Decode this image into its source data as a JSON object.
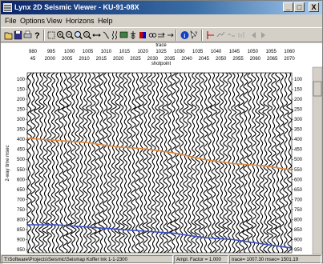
{
  "window": {
    "title": "Lynx 2D Seismic Viewer - KU-91-08X",
    "controls": [
      "_",
      "□",
      "X"
    ]
  },
  "menu": [
    "File",
    "Options",
    "View",
    "Horizons",
    "Help"
  ],
  "toolbar": {
    "icons": [
      "open-file-icon",
      "save-icon",
      "print-icon",
      "question-icon",
      "select-icon",
      "zoom-in-icon",
      "zoom-out-icon",
      "zoom-area-icon",
      "zoom-fit-icon",
      "pan-icon",
      "measure-icon",
      "wiggle-icon",
      "display-icon",
      "gain-icon",
      "color-icon",
      "link-icon",
      "refresh-icon",
      "info-icon",
      "help-pointer-icon",
      "pick-horizon-icon",
      "pick-line-icon",
      "edit-horizon-icon",
      "snap-icon",
      "back-icon",
      "forward-icon"
    ]
  },
  "plot": {
    "top_axis_title_1": "trace",
    "top_axis_title_2": "shotpoint",
    "trace_ticks": [
      "980",
      "995",
      "1000",
      "1005",
      "1010",
      "1015",
      "1020",
      "1025",
      "1030",
      "1035",
      "1040",
      "1045",
      "1050",
      "1055",
      "1060"
    ],
    "shotpoint_ticks": [
      "45",
      "2000",
      "2005",
      "2010",
      "2015",
      "2020",
      "2025",
      "2030",
      "2035",
      "2040",
      "2045",
      "2050",
      "2055",
      "2060",
      "2065",
      "2070"
    ],
    "y_axis_label": "2-way time msec",
    "time_ticks": [
      "100",
      "150",
      "200",
      "250",
      "300",
      "350",
      "400",
      "450",
      "500",
      "550",
      "600",
      "650",
      "700",
      "750",
      "800",
      "850",
      "900",
      "950"
    ],
    "horizons": [
      {
        "color": "#e08a3c",
        "y": [
          0.45,
          0.46,
          0.47,
          0.49,
          0.5,
          0.52,
          0.55,
          0.57,
          0.58,
          0.6
        ]
      },
      {
        "color": "#3a4ec8",
        "y": [
          0.86,
          0.86,
          0.87,
          0.88,
          0.89,
          0.9,
          0.92,
          0.93,
          0.95,
          0.97
        ]
      }
    ]
  },
  "status": {
    "path": "T:\\Software\\Projects\\Seismic\\Seismap Koffer Ink 1-1-2300",
    "factor": "Ampl. Factor = 1.000",
    "trace": "trace= 1007.30 msec= 1501.19"
  }
}
